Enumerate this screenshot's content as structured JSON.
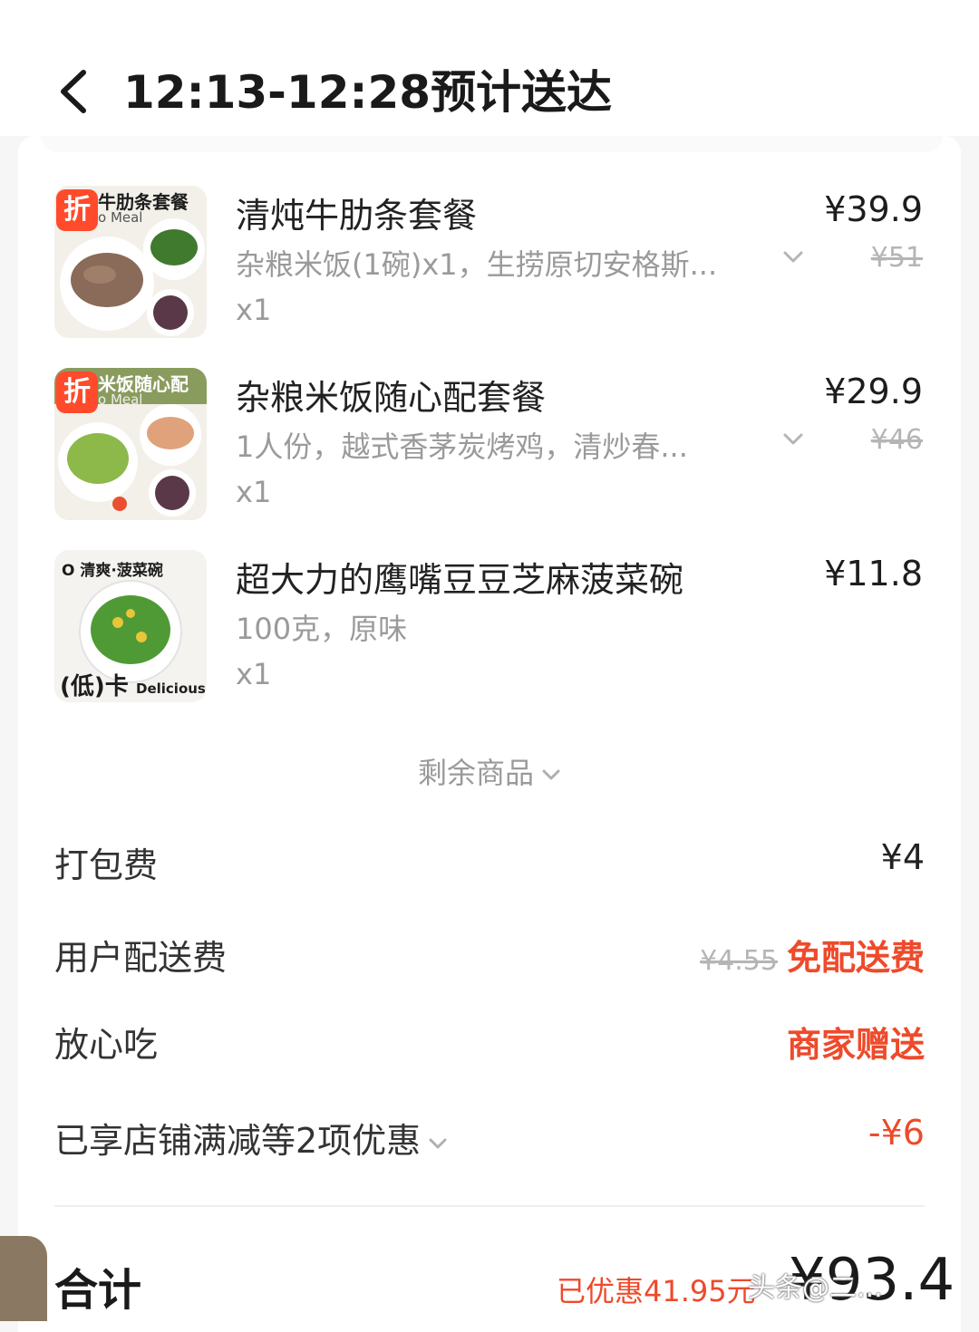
{
  "header": {
    "title": "12:13-12:28预计送达"
  },
  "items": [
    {
      "thumb_label": "牛肋条套餐",
      "thumb_sub": "o Meal",
      "discount_tag": "折",
      "name": "清炖牛肋条套餐",
      "spec": "杂粮米饭(1碗)x1，生捞原切安格斯...",
      "qty": "x1",
      "price": "¥39.9",
      "original_price": "¥51"
    },
    {
      "thumb_label": "米饭随心配",
      "thumb_sub": "o Meal",
      "discount_tag": "折",
      "name": "杂粮米饭随心配套餐",
      "spec": "1人份，越式香茅炭烤鸡，清炒春...",
      "qty": "x1",
      "price": "¥29.9",
      "original_price": "¥46"
    },
    {
      "thumb_label": "O 清爽·菠菜碗",
      "thumb_footer": "(低)卡",
      "thumb_footer_en": "Delicious.",
      "name": "超大力的鹰嘴豆豆芝麻菠菜碗",
      "spec": "100克，原味",
      "qty": "x1",
      "price": "¥11.8"
    }
  ],
  "remaining": {
    "label": "剩余商品"
  },
  "fees": {
    "packing": {
      "label": "打包费",
      "value": "¥4"
    },
    "delivery": {
      "label": "用户配送费",
      "original": "¥4.55",
      "value": "免配送费"
    },
    "assurance": {
      "label": "放心吃",
      "value": "商家赠送"
    },
    "discounts": {
      "label": "已享店铺满减等2项优惠",
      "value": "-¥6"
    }
  },
  "total": {
    "label": "合计",
    "saved": "已优惠41.95元",
    "amount": "¥93.4"
  },
  "watermark": "头条@二...",
  "colors": {
    "accent_red": "#ee4a2b",
    "tag_red": "#ff4b2b",
    "grey_text": "#9a9a9a",
    "side_tab": "#8b7862"
  }
}
